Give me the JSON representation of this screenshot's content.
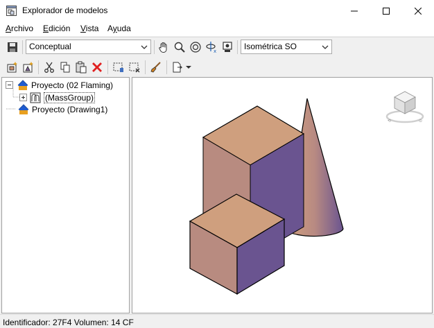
{
  "window": {
    "title": "Explorador de modelos",
    "buttons": [
      "minimize",
      "maximize",
      "close"
    ]
  },
  "menu": {
    "items": [
      {
        "label_underlined": "A",
        "label_rest": "rchivo"
      },
      {
        "label_underlined": "E",
        "label_rest": "dición"
      },
      {
        "label_underlined": "V",
        "label_rest": "ista"
      },
      {
        "label_prefix": "A",
        "label_underlined": "y",
        "label_rest": "uda"
      }
    ]
  },
  "toolbar1": {
    "visual_style": "Conceptual",
    "view_direction": "Isométrica SO",
    "icons": [
      "save-icon",
      "pan-icon",
      "zoom-icon",
      "orbit-icon",
      "orbit-x-icon",
      "camera-icon"
    ]
  },
  "toolbar2": {
    "icons": [
      "new-project-icon",
      "new-group-icon",
      "cut-icon",
      "copy-icon",
      "paste-icon",
      "delete-icon",
      "select-icon",
      "deselect-icon",
      "brush-icon",
      "export-icon",
      "dropdown-arrow-icon"
    ]
  },
  "tree": {
    "nodes": [
      {
        "label": "Proyecto (02 Flaming)"
      },
      {
        "label": "(MassGroup)"
      },
      {
        "label": "Proyecto (Drawing1)"
      }
    ]
  },
  "status": {
    "text": "Identificador: 27F4  Volumen: 14 CF"
  },
  "colors": {
    "mass_light": "#cf9f7e",
    "mass_mid": "#b88b80",
    "mass_dark": "#6a5490"
  }
}
